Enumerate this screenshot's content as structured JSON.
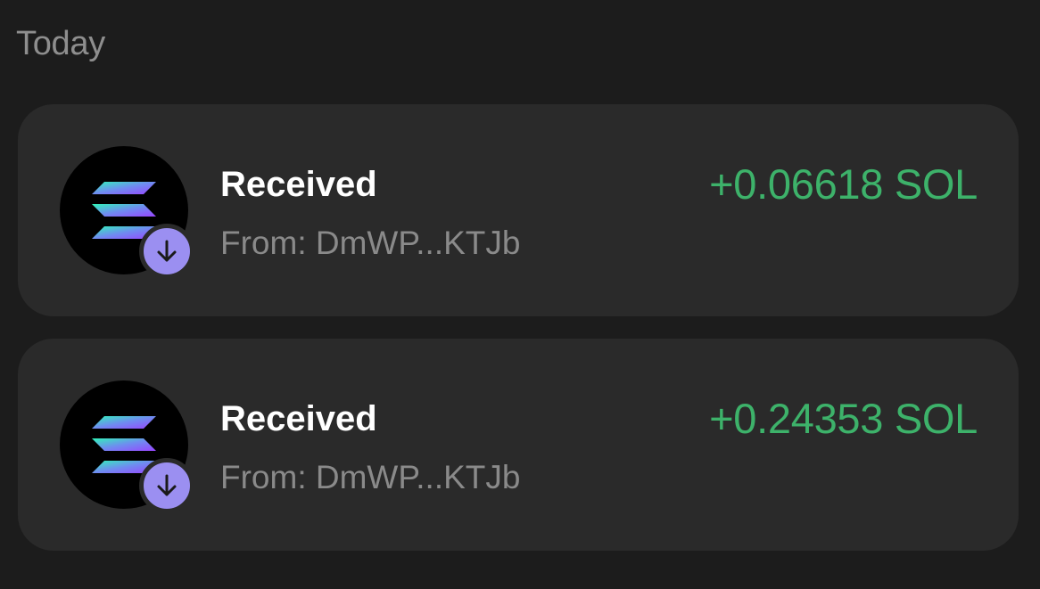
{
  "section": {
    "title": "Today"
  },
  "colors": {
    "background": "#1c1c1c",
    "card": "#2a2a2a",
    "amount_positive": "#3db26a",
    "badge": "#9b8ff1",
    "sub_text": "#8a8a8a"
  },
  "transactions": [
    {
      "title": "Received",
      "from": "From: DmWP...KTJb",
      "amount": "+0.06618 SOL",
      "token_icon": "solana-icon",
      "badge_icon": "arrow-down-icon"
    },
    {
      "title": "Received",
      "from": "From: DmWP...KTJb",
      "amount": "+0.24353 SOL",
      "token_icon": "solana-icon",
      "badge_icon": "arrow-down-icon"
    }
  ]
}
